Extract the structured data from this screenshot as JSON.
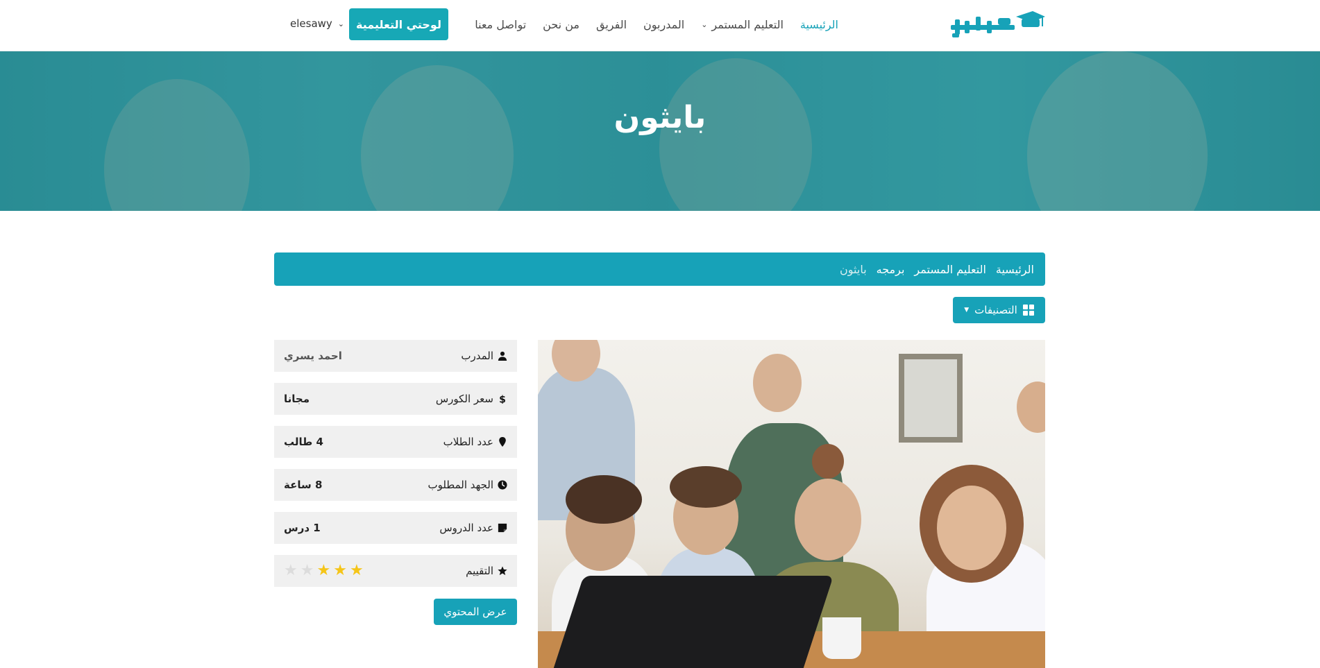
{
  "brand": {
    "name": "كاريري",
    "color": "#17a2b8",
    "logo_icon": "graduation-cap-icon"
  },
  "nav": {
    "items": [
      {
        "label": "الرئيسية",
        "active": true
      },
      {
        "label": "التعليم المستمر",
        "dropdown": true
      },
      {
        "label": "المدربون"
      },
      {
        "label": "الفريق"
      },
      {
        "label": "من نحن"
      },
      {
        "label": "تواصل معنا"
      }
    ],
    "dashboard_label": "لوحتي التعليمية",
    "user_name": "elesawy"
  },
  "hero": {
    "title": "بايثون"
  },
  "breadcrumb": {
    "items": [
      "الرئيسية",
      "التعليم المستمر",
      "برمجه"
    ],
    "current": "بايثون"
  },
  "categories_button": {
    "label": "التصنيفات",
    "icon": "grid-icon"
  },
  "course_info": {
    "instructor": {
      "label": "المدرب",
      "value": "احمد يسري",
      "icon": "user-icon"
    },
    "price": {
      "label": "سعر الكورس",
      "value": "مجانا",
      "icon": "dollar-icon"
    },
    "students": {
      "label": "عدد الطلاب",
      "value": "4 طالب",
      "icon": "map-marker-icon"
    },
    "effort": {
      "label": "الجهد المطلوب",
      "value": "8 ساعة",
      "icon": "clock-icon"
    },
    "lessons": {
      "label": "عدد الدروس",
      "value": "1 درس",
      "icon": "sticky-note-icon"
    },
    "rating": {
      "label": "التقييم",
      "value": 3,
      "max": 5,
      "icon": "star-icon"
    }
  },
  "view_content_label": "عرض المحتوي"
}
